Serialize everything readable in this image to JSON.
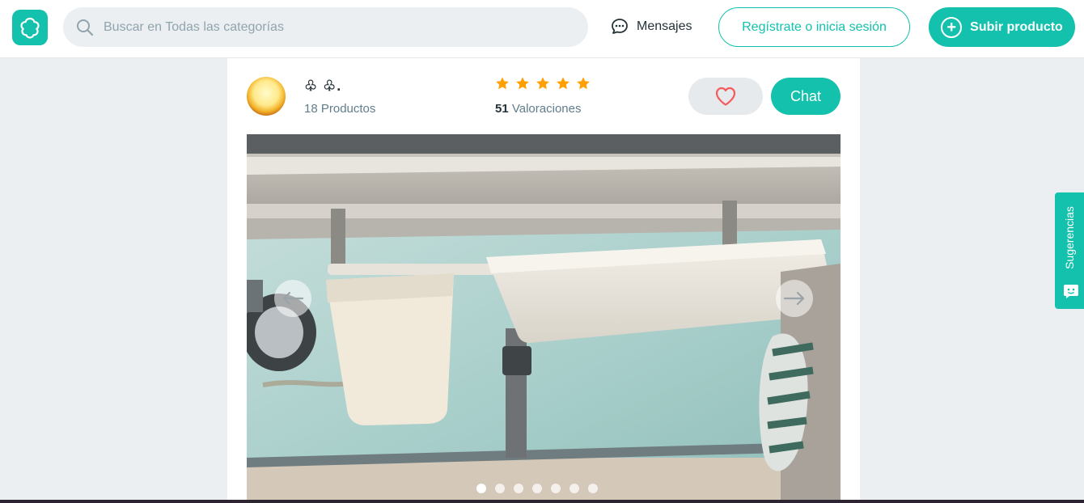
{
  "header": {
    "logo_icon": "wallapop-logo-icon",
    "search_placeholder": "Buscar en Todas las categorías",
    "messages_label": "Mensajes",
    "register_label": "Regístrate o inicia sesión",
    "upload_label": "Subir producto"
  },
  "seller": {
    "name": "♧ ♧.",
    "products": "18 Productos",
    "rating_stars": 5,
    "ratings_count": "51",
    "ratings_label": "Valoraciones"
  },
  "actions": {
    "favorite_icon": "heart-icon",
    "chat_label": "Chat"
  },
  "gallery": {
    "total_images": 7,
    "active_index": 0
  },
  "feedback": {
    "label": "Sugerencias"
  },
  "colors": {
    "accent": "#13c1ac",
    "star": "#ffa000",
    "heart": "#f35b5b"
  }
}
